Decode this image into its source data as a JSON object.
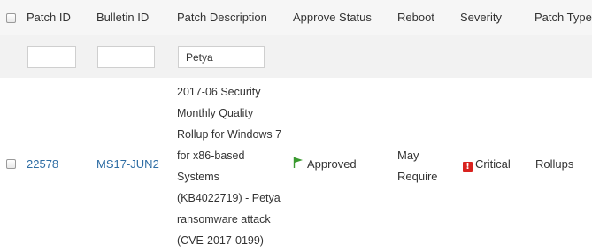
{
  "table": {
    "columns": {
      "patch_id": "Patch ID",
      "bulletin_id": "Bulletin ID",
      "patch_description": "Patch Description",
      "approve_status": "Approve Status",
      "reboot": "Reboot",
      "severity": "Severity",
      "patch_type": "Patch Type"
    },
    "filters": {
      "patch_id": "",
      "bulletin_id": "",
      "patch_description": "Petya"
    },
    "rows": [
      {
        "patch_id": "22578",
        "bulletin_id": "MS17-JUN2",
        "description_lines": [
          "2017-06 Security",
          "Monthly Quality",
          "Rollup for Windows 7",
          "for x86-based",
          "Systems",
          "(KB4022719) - Petya",
          "ransomware attack",
          "(CVE-2017-0199)"
        ],
        "approve_status": "Approved",
        "approve_icon": "green-flag-icon",
        "reboot_lines": [
          "May",
          "Require"
        ],
        "severity": "Critical",
        "severity_icon": "critical-exclamation-icon",
        "patch_type": "Rollups"
      }
    ]
  },
  "colors": {
    "link": "#2e6da4",
    "critical": "#d9231f",
    "approved_flag": "#3a9a2f",
    "header_bg": "#f6f6f6"
  }
}
